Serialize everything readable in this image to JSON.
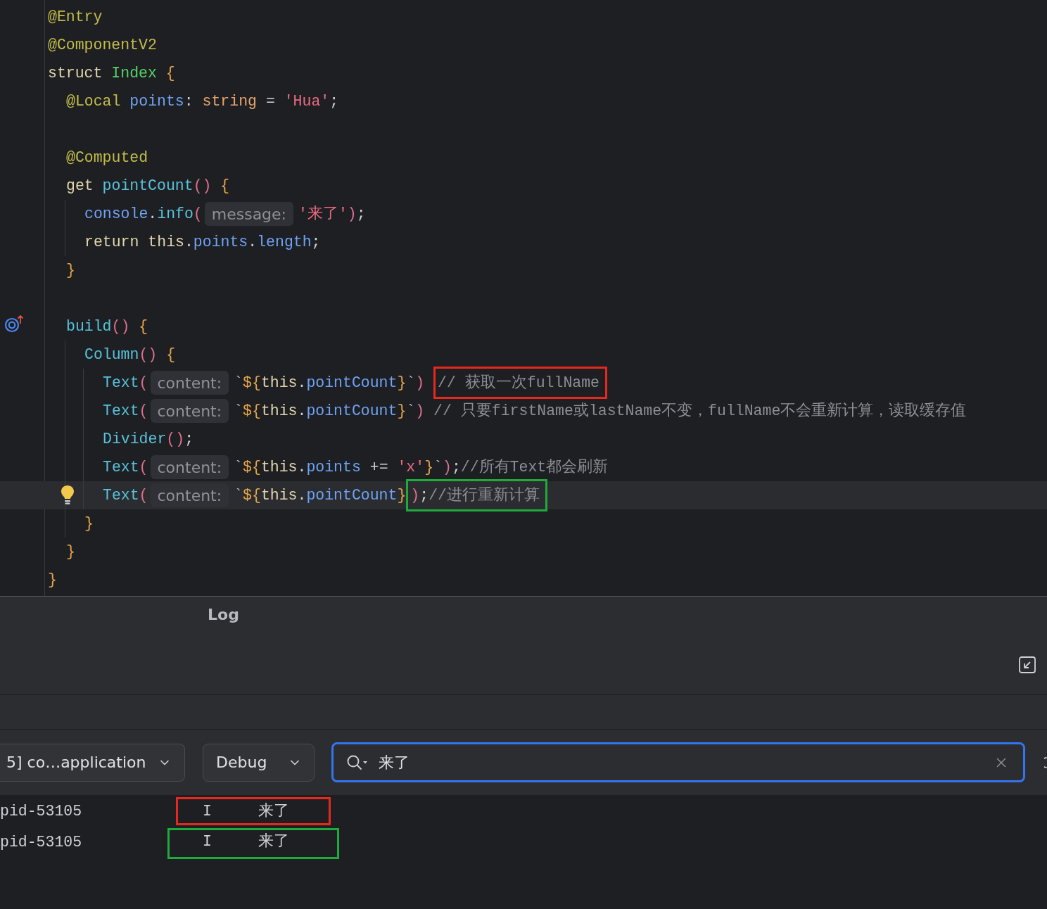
{
  "editor": {
    "lines": [
      {
        "selected": false,
        "tokens": [
          {
            "text": "@Entry",
            "kind": "annotation"
          }
        ]
      },
      {
        "selected": false,
        "tokens": [
          {
            "text": "@ComponentV2",
            "kind": "annotation"
          }
        ]
      },
      {
        "selected": false,
        "tokens": [
          {
            "text": "struct ",
            "kind": "keyword"
          },
          {
            "text": "Index",
            "kind": "class"
          },
          {
            "text": " {",
            "kind": "brace"
          }
        ],
        "children": [
          {
            "selected": false,
            "tokens": [
              {
                "text": "@Local ",
                "kind": "annotation"
              },
              {
                "text": "points",
                "kind": "field"
              },
              {
                "text": ": ",
                "kind": "punct"
              },
              {
                "text": "string",
                "kind": "type"
              },
              {
                "text": " = ",
                "kind": "punct"
              },
              {
                "text": "'Hua'",
                "kind": "string"
              },
              {
                "text": ";",
                "kind": "punct"
              }
            ]
          },
          {
            "selected": false
          },
          {
            "selected": false,
            "tokens": [
              {
                "text": "@Computed",
                "kind": "annotation"
              }
            ]
          },
          {
            "selected": false,
            "tokens": [
              {
                "text": "get ",
                "kind": "keyword"
              },
              {
                "text": "pointCount",
                "kind": "function"
              },
              {
                "text": "()",
                "kind": "paren"
              },
              {
                "text": " {",
                "kind": "brace"
              }
            ],
            "children": [
              {
                "selected": false,
                "tokens": [
                  {
                    "text": "console",
                    "kind": "field"
                  },
                  {
                    "text": ".",
                    "kind": "punct"
                  },
                  {
                    "text": "info",
                    "kind": "function"
                  },
                  {
                    "text": "(",
                    "kind": "paren"
                  },
                  {
                    "text": "message:",
                    "kind": "hint"
                  },
                  {
                    "text": "'来了'",
                    "kind": "string"
                  },
                  {
                    "text": ")",
                    "kind": "paren"
                  },
                  {
                    "text": ";",
                    "kind": "punct"
                  }
                ]
              },
              {
                "selected": false,
                "tokens": [
                  {
                    "text": "return ",
                    "kind": "keyword"
                  },
                  {
                    "text": "this",
                    "kind": "keyword"
                  },
                  {
                    "text": ".",
                    "kind": "punct"
                  },
                  {
                    "text": "points",
                    "kind": "field"
                  },
                  {
                    "text": ".",
                    "kind": "punct"
                  },
                  {
                    "text": "length",
                    "kind": "field"
                  },
                  {
                    "text": ";",
                    "kind": "punct"
                  }
                ]
              }
            ]
          },
          {
            "selected": false,
            "tokens": [
              {
                "text": "}",
                "kind": "brace"
              }
            ]
          },
          {
            "selected": false
          },
          {
            "selected": false,
            "marker": {
              "kind": "override"
            },
            "tokens": [
              {
                "text": "build",
                "kind": "function"
              },
              {
                "text": "()",
                "kind": "paren"
              },
              {
                "text": " {",
                "kind": "brace"
              }
            ],
            "children": [
              {
                "selected": false,
                "tokens": [
                  {
                    "text": "Column",
                    "kind": "function"
                  },
                  {
                    "text": "()",
                    "kind": "paren"
                  },
                  {
                    "text": " {",
                    "kind": "brace"
                  }
                ],
                "children": [
                  {
                    "selected": false,
                    "tokens": [
                      {
                        "text": "Text",
                        "kind": "function"
                      },
                      {
                        "text": "(",
                        "kind": "paren"
                      },
                      {
                        "text": "content:",
                        "kind": "hint"
                      },
                      {
                        "text": "`",
                        "kind": "template"
                      },
                      {
                        "text": "${",
                        "kind": "brace"
                      },
                      {
                        "text": "this",
                        "kind": "keyword"
                      },
                      {
                        "text": ".",
                        "kind": "punct"
                      },
                      {
                        "text": "pointCount",
                        "kind": "field"
                      },
                      {
                        "text": "}",
                        "kind": "brace"
                      },
                      {
                        "text": "`",
                        "kind": "template"
                      },
                      {
                        "text": ") ",
                        "kind": "paren"
                      },
                      {
                        "kind": "frame",
                        "color": "#e6281e",
                        "tokens": [
                          {
                            "text": "// 获取一次fullName",
                            "kind": "comment"
                          }
                        ]
                      }
                    ]
                  },
                  {
                    "selected": false,
                    "tokens": [
                      {
                        "text": "Text",
                        "kind": "function"
                      },
                      {
                        "text": "(",
                        "kind": "paren"
                      },
                      {
                        "text": "content:",
                        "kind": "hint"
                      },
                      {
                        "text": "`",
                        "kind": "template"
                      },
                      {
                        "text": "${",
                        "kind": "brace"
                      },
                      {
                        "text": "this",
                        "kind": "keyword"
                      },
                      {
                        "text": ".",
                        "kind": "punct"
                      },
                      {
                        "text": "pointCount",
                        "kind": "field"
                      },
                      {
                        "text": "}",
                        "kind": "brace"
                      },
                      {
                        "text": "`",
                        "kind": "template"
                      },
                      {
                        "text": ") ",
                        "kind": "paren"
                      },
                      {
                        "text": "// 只要firstName或lastName不变，fullName不会重新计算，读取缓存值",
                        "kind": "comment"
                      }
                    ]
                  },
                  {
                    "selected": false,
                    "tokens": [
                      {
                        "text": "Divider",
                        "kind": "function"
                      },
                      {
                        "text": "()",
                        "kind": "paren"
                      },
                      {
                        "text": ";",
                        "kind": "punct"
                      }
                    ]
                  },
                  {
                    "selected": false,
                    "tokens": [
                      {
                        "text": "Text",
                        "kind": "function"
                      },
                      {
                        "text": "(",
                        "kind": "paren"
                      },
                      {
                        "text": "content:",
                        "kind": "hint"
                      },
                      {
                        "text": "`",
                        "kind": "template"
                      },
                      {
                        "text": "${",
                        "kind": "brace"
                      },
                      {
                        "text": "this",
                        "kind": "keyword"
                      },
                      {
                        "text": ".",
                        "kind": "punct"
                      },
                      {
                        "text": "points",
                        "kind": "field"
                      },
                      {
                        "text": " += ",
                        "kind": "punct"
                      },
                      {
                        "text": "'x'",
                        "kind": "string"
                      },
                      {
                        "text": "}",
                        "kind": "brace"
                      },
                      {
                        "text": "`",
                        "kind": "template"
                      },
                      {
                        "text": ")",
                        "kind": "paren"
                      },
                      {
                        "text": ";",
                        "kind": "punct"
                      },
                      {
                        "text": "//所有Text都会刷新",
                        "kind": "comment"
                      }
                    ]
                  },
                  {
                    "selected": true,
                    "marker": {
                      "kind": "bulb"
                    },
                    "tokens": [
                      {
                        "text": "Text",
                        "kind": "function"
                      },
                      {
                        "text": "(",
                        "kind": "paren"
                      },
                      {
                        "text": "content:",
                        "kind": "hint"
                      },
                      {
                        "text": "`",
                        "kind": "template"
                      },
                      {
                        "text": "${",
                        "kind": "brace"
                      },
                      {
                        "text": "this",
                        "kind": "keyword"
                      },
                      {
                        "text": ".",
                        "kind": "punct"
                      },
                      {
                        "text": "pointCount",
                        "kind": "field"
                      },
                      {
                        "text": "}",
                        "kind": "brace"
                      },
                      {
                        "kind": "frame",
                        "color": "#1faa3c",
                        "tokens": [
                          {
                            "text": ")",
                            "kind": "paren"
                          },
                          {
                            "text": ";",
                            "kind": "punct"
                          },
                          {
                            "text": "//进行重新计算",
                            "kind": "comment"
                          }
                        ]
                      }
                    ]
                  }
                ]
              },
              {
                "selected": false,
                "tokens": [
                  {
                    "text": "}",
                    "kind": "brace"
                  }
                ]
              }
            ]
          },
          {
            "selected": false,
            "tokens": [
              {
                "text": "}",
                "kind": "brace"
              }
            ]
          }
        ]
      },
      {
        "selected": false,
        "tokens": [
          {
            "text": "}",
            "kind": "brace"
          }
        ]
      }
    ]
  },
  "log_panel": {
    "title": "Log",
    "process_dropdown": {
      "value": "5] co…application"
    },
    "level_dropdown": {
      "value": "Debug"
    },
    "search_field": {
      "value": "来了",
      "focused": true
    },
    "rows": [
      {
        "process": "pid-53105",
        "priority": "I",
        "message": "来了",
        "frame": {
          "color": "#e6281e"
        }
      },
      {
        "process": "pid-53105",
        "priority": "I",
        "message": "来了",
        "frame": {
          "color": "#1faa3c"
        }
      }
    ]
  }
}
